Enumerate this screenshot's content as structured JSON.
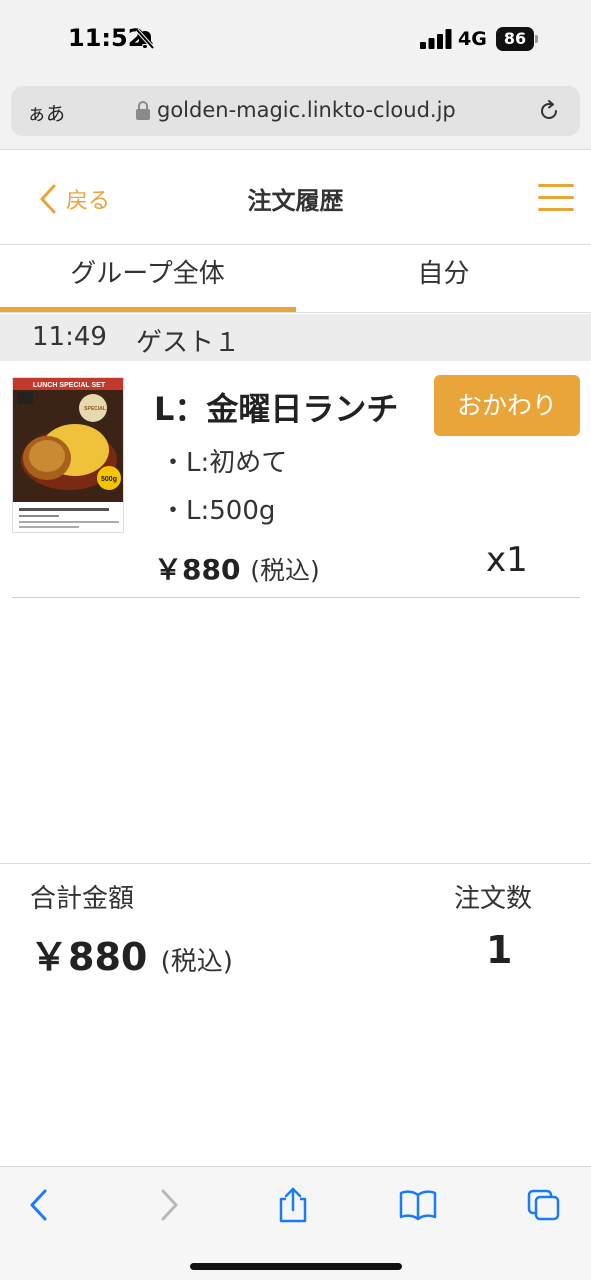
{
  "status_bar": {
    "time": "11:52",
    "network": "4G",
    "battery": "86"
  },
  "browser": {
    "text_size_label": "ぁあ",
    "url": "golden-magic.linkto-cloud.jp"
  },
  "header": {
    "back_label": "戻る",
    "title": "注文履歴"
  },
  "tabs": [
    {
      "label": "グループ全体",
      "active": true
    },
    {
      "label": "自分",
      "active": false
    }
  ],
  "guest": {
    "time": "11:49",
    "name": "ゲスト１"
  },
  "order": {
    "name": "L：金曜日ランチ",
    "refill_label": "おかわり",
    "options": [
      "・L:初めて",
      "・L:500g"
    ],
    "price": "￥880",
    "tax_note": "(税込)",
    "quantity": "x1",
    "thumbnail_text": {
      "banner": "LUNCH SPECIAL SET",
      "badge": "500g",
      "stamp": "SPECIAL"
    }
  },
  "summary": {
    "total_label": "合計金額",
    "total_value": "￥880",
    "tax_note": "(税込)",
    "count_label": "注文数",
    "count_value": "1"
  },
  "colors": {
    "accent": "#e9a43a",
    "ios_blue": "#1a7cf5"
  }
}
